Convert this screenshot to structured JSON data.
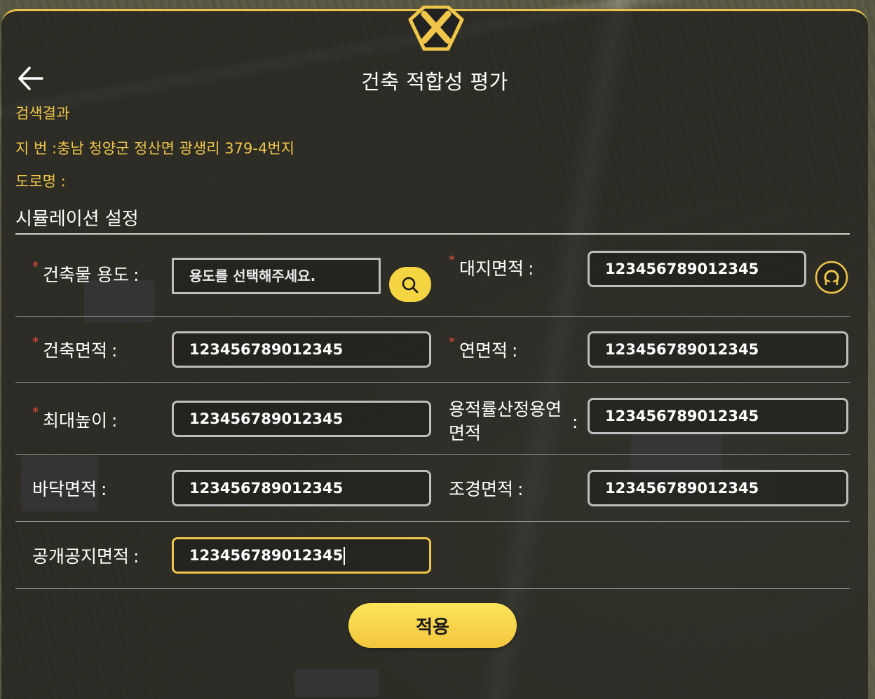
{
  "header": {
    "title": "건축 적합성 평가",
    "back_icon": "arrow-left-icon",
    "close_icon": "close-x-icon"
  },
  "search_result": {
    "heading": "검색결과",
    "lot_label": "지 번 :",
    "lot_value": "충남 청양군 정산면 광생리 379-4번지",
    "road_label": "도로명 :",
    "road_value": ""
  },
  "simulation": {
    "heading": "시뮬레이션 설정"
  },
  "form": {
    "building_use": {
      "label": "건축물 용도",
      "required": true,
      "placeholder": "용도를 선택해주세요.",
      "search_icon": "search-icon"
    },
    "site_area": {
      "label": "대지면적",
      "required": true,
      "value": "123456789012345",
      "reset_icon": "refresh-icon"
    },
    "building_area": {
      "label": "건축면적",
      "required": true,
      "value": "123456789012345"
    },
    "gross_floor_area": {
      "label": "연면적",
      "required": true,
      "value": "123456789012345"
    },
    "max_height": {
      "label": "최대높이",
      "required": true,
      "value": "123456789012345"
    },
    "far_floor_area": {
      "label_line1": "용적률산정용연",
      "label_line2": "면적",
      "required": false,
      "value": "123456789012345"
    },
    "floor_area": {
      "label": "바닥면적",
      "required": false,
      "value": "123456789012345"
    },
    "landscape_area": {
      "label": "조경면적",
      "required": false,
      "value": "123456789012345"
    },
    "open_space_area": {
      "label": "공개공지면적",
      "required": false,
      "value": "123456789012345"
    },
    "colon": ":",
    "required_mark": "*"
  },
  "actions": {
    "apply_label": "적용"
  },
  "colors": {
    "accent": "#f0c64a",
    "required": "#e74c3c",
    "button": "#f5d442"
  }
}
